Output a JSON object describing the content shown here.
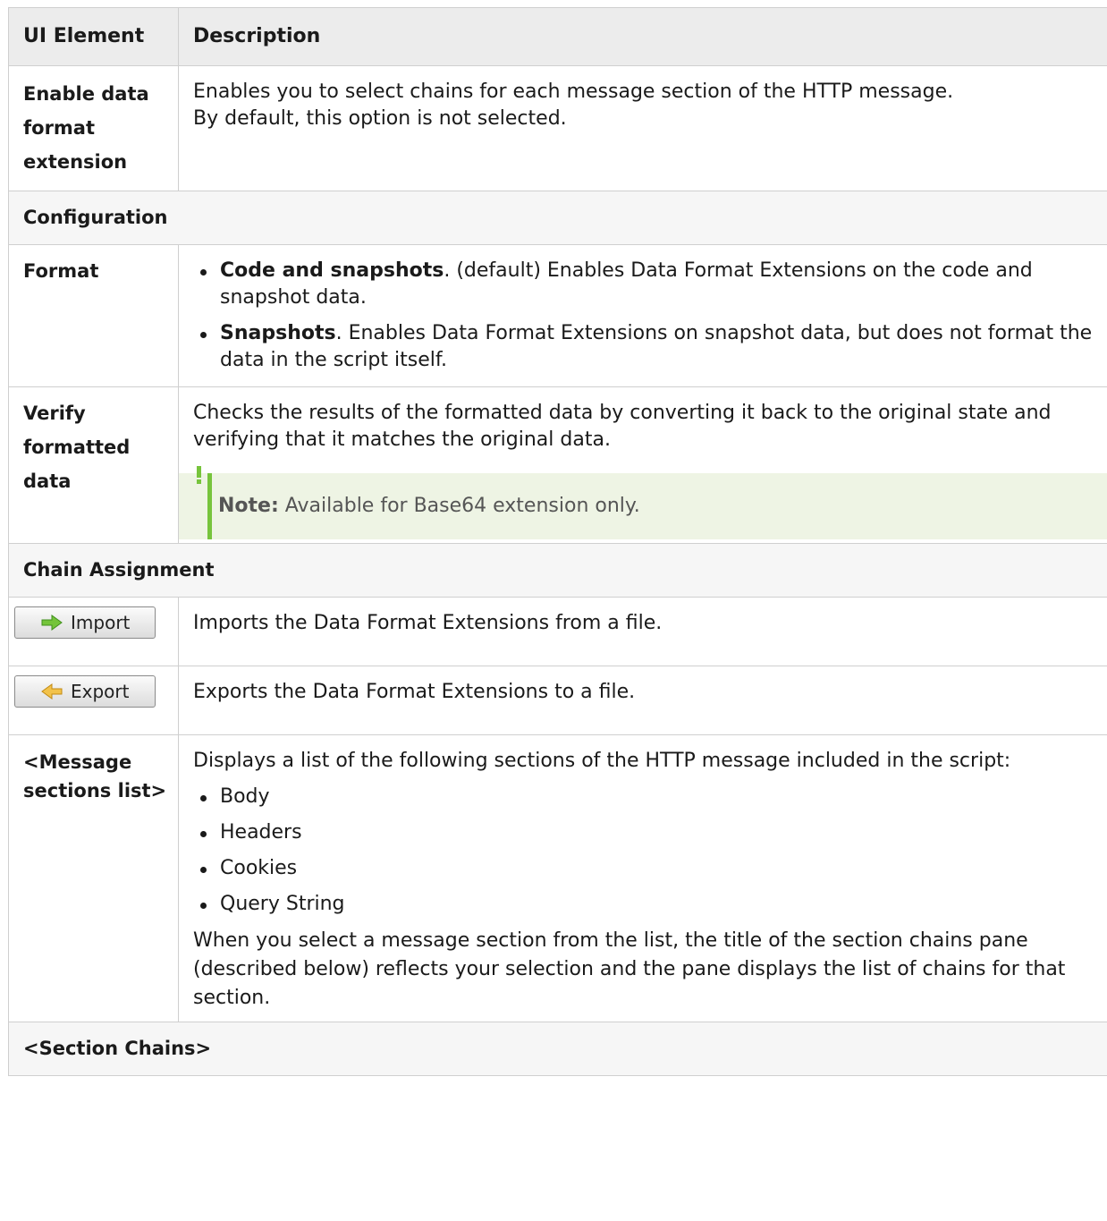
{
  "header": {
    "col1": "UI Element",
    "col2": "Description"
  },
  "rows": {
    "enable": {
      "label": "Enable data format extension",
      "line1": "Enables you to select chains for each message section of the HTTP message.",
      "line2": "By default, this option is not selected."
    },
    "configuration": {
      "label": "Configuration"
    },
    "format": {
      "label": "Format",
      "b1_bold": "Code and snapshots",
      "b1_text": ". (default) Enables Data Format Extensions on the code and snapshot data.",
      "b2_bold": "Snapshots",
      "b2_text": ". Enables Data Format Extensions on snapshot data, but does not format the data in the script itself."
    },
    "verify": {
      "label": "Verify formatted data",
      "text": "Checks the results of the formatted data by converting it back to the original state and verifying that it matches the original data.",
      "note_label": "Note:",
      "note_text": " Available for Base64 extension only."
    },
    "chain": {
      "label": "Chain Assignment"
    },
    "import": {
      "button_label": "Import",
      "icon": "arrow-right-icon",
      "text": "Imports the Data Format Extensions from a file."
    },
    "export": {
      "button_label": "Export",
      "icon": "arrow-left-icon",
      "text": "Exports the Data Format Extensions to a file."
    },
    "message": {
      "label": "<Message sections list>",
      "intro": "Displays a list of the following sections of the HTTP message included in the script:",
      "items": [
        "Body",
        "Headers",
        "Cookies",
        "Query String"
      ],
      "outro": "When you select a message section from the list, the title of the section chains pane (described below) reflects your selection and the pane displays the list of chains for that section."
    },
    "section_chains": {
      "label": "<Section Chains>"
    }
  },
  "colors": {
    "note_accent": "#77c43c",
    "note_bg": "#eef4e4",
    "header_bg": "#ececec"
  }
}
